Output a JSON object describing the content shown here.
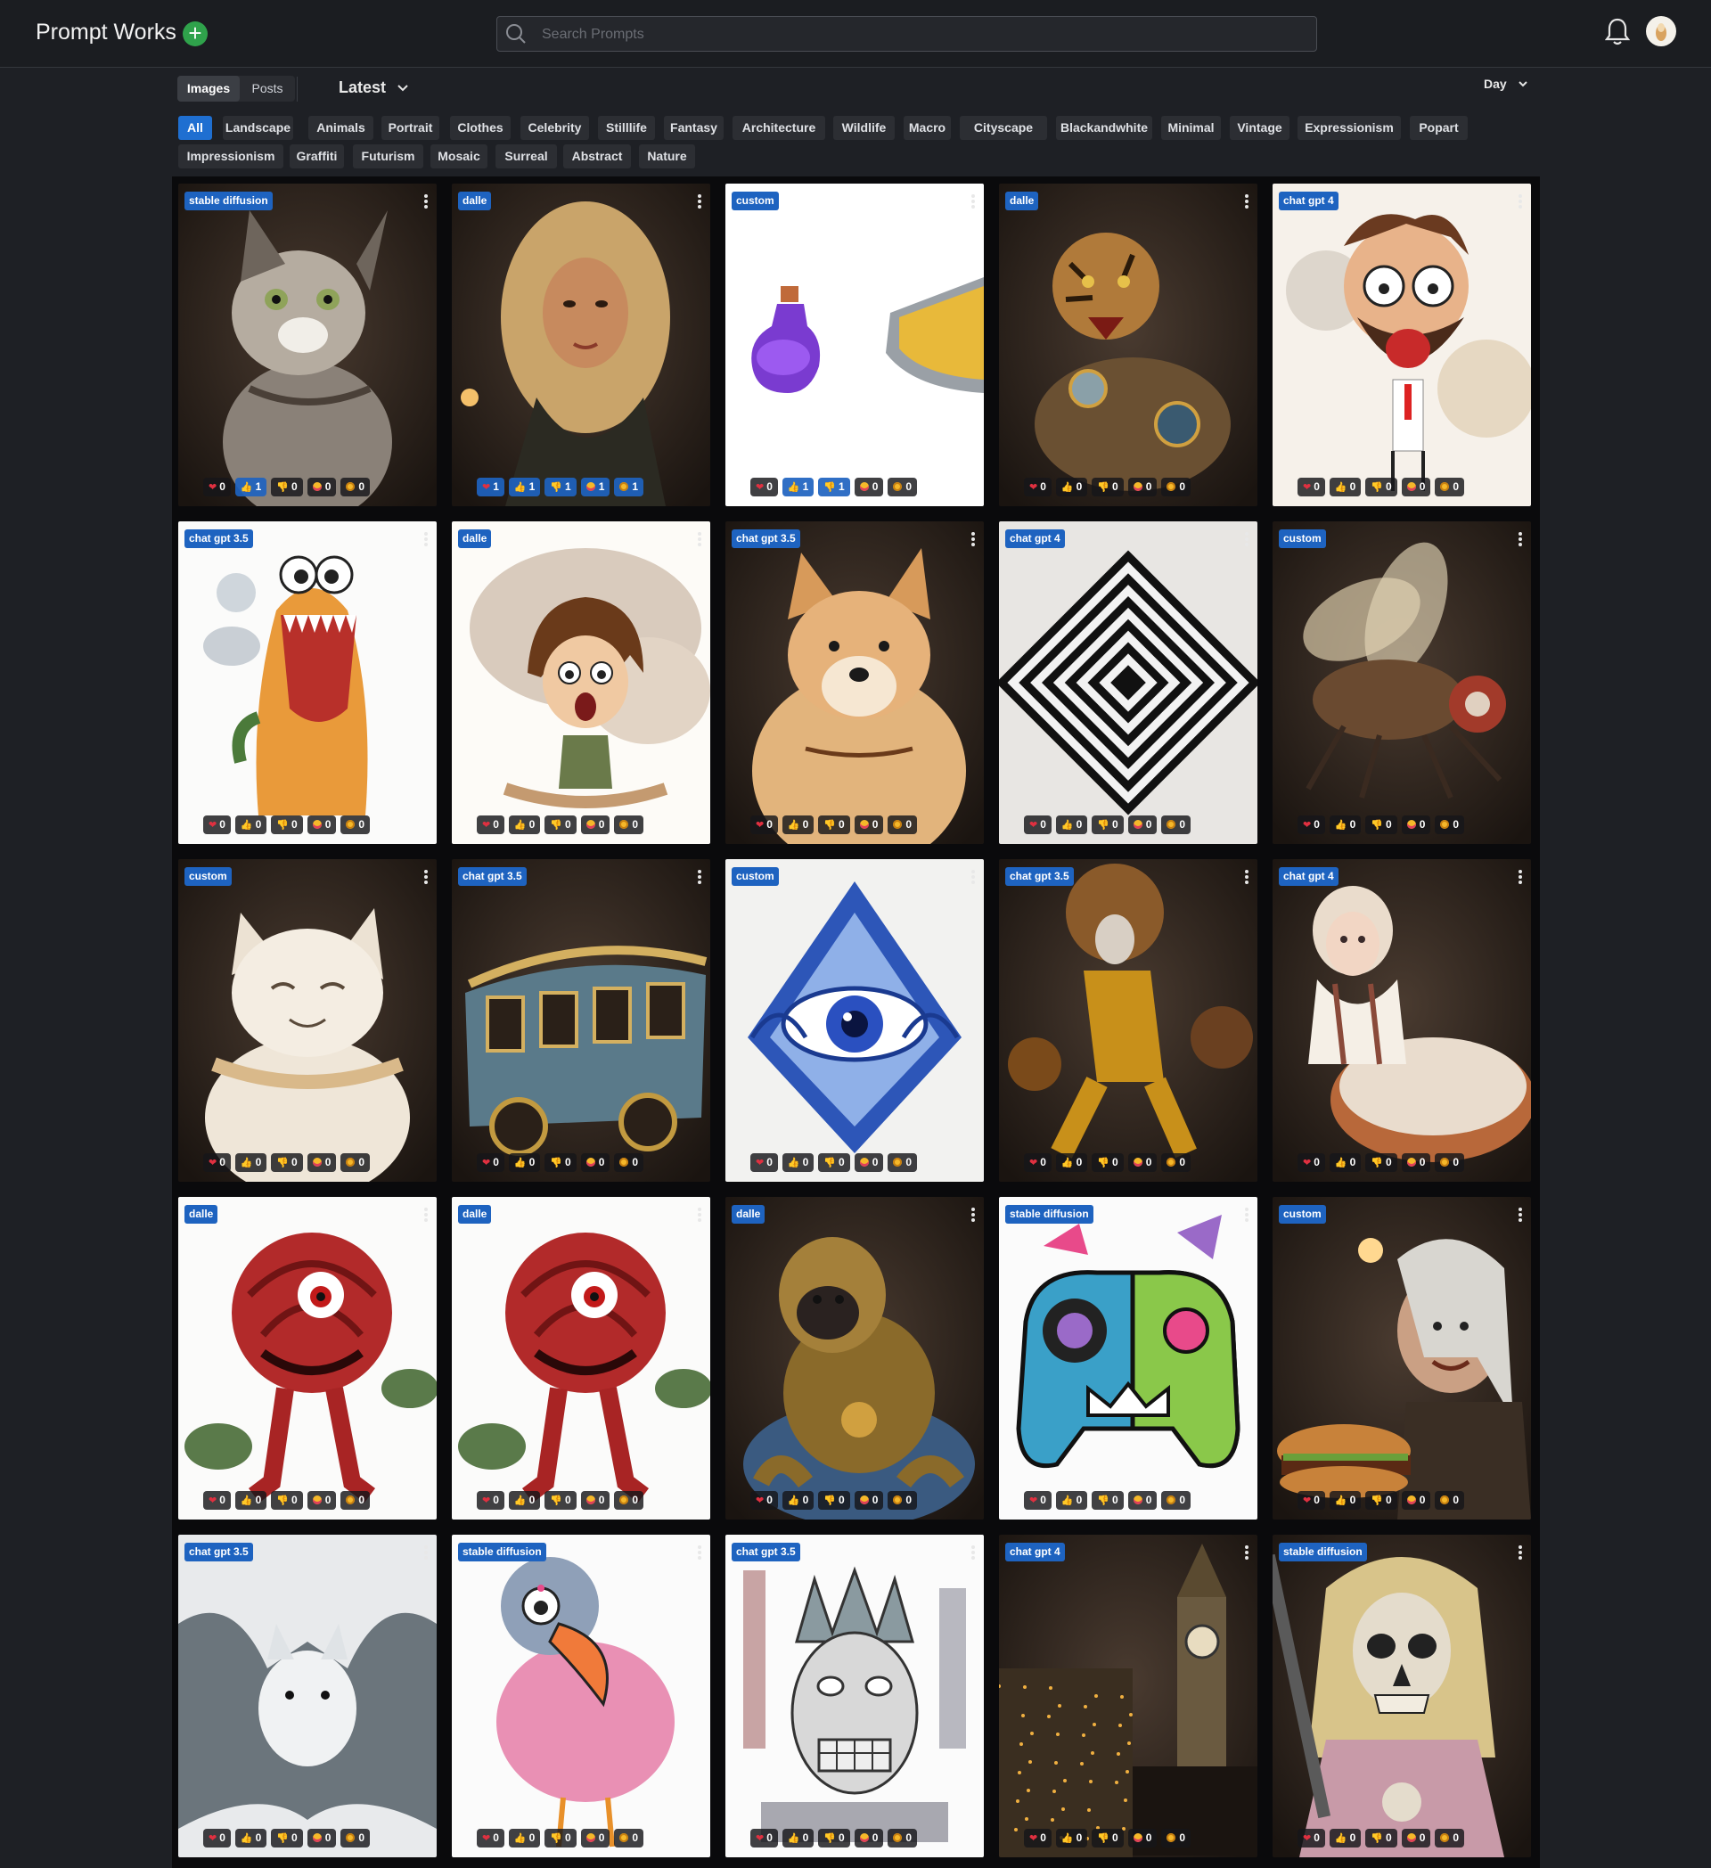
{
  "header": {
    "brand": "Prompt Works",
    "add_icon": "plus-circle-icon",
    "search_placeholder": "Search Prompts",
    "search_value": "",
    "notification_icon": "bell-icon",
    "avatar_icon": "user-avatar"
  },
  "toolbar": {
    "view_tabs": [
      {
        "label": "Images",
        "active": true
      },
      {
        "label": "Posts",
        "active": false
      }
    ],
    "sort_label": "Latest",
    "range_label": "Day"
  },
  "categories": [
    "All",
    "Landscape",
    "Animals",
    "Portrait",
    "Clothes",
    "Celebrity",
    "Stilllife",
    "Fantasy",
    "Architecture",
    "Wildlife",
    "Macro",
    "Cityscape",
    "Blackandwhite",
    "Minimal",
    "Vintage",
    "Expressionism",
    "Popart",
    "Impressionism",
    "Graffiti",
    "Futurism",
    "Mosaic",
    "Surreal",
    "Abstract",
    "Nature"
  ],
  "active_category": "All",
  "reaction_icons": [
    "heart",
    "thumbs-up",
    "thumbs-down",
    "love-face",
    "dizzy-face"
  ],
  "colors": {
    "accent": "#1e63c0",
    "add": "#2fa24b",
    "background": "#1e2025"
  },
  "cards": [
    {
      "model": "stable diffusion",
      "subject": "tabby-cat",
      "reactions": [
        0,
        1,
        0,
        0,
        0
      ]
    },
    {
      "model": "dalle",
      "subject": "blonde-woman-portrait",
      "reactions": [
        1,
        1,
        1,
        1,
        1
      ]
    },
    {
      "model": "custom",
      "subject": "potion-and-shield",
      "reactions": [
        0,
        1,
        1,
        0,
        0
      ]
    },
    {
      "model": "dalle",
      "subject": "mechanical-tiger",
      "reactions": [
        0,
        0,
        0,
        0,
        0
      ]
    },
    {
      "model": "chat gpt 4",
      "subject": "screaming-cartoon-man",
      "reactions": [
        0,
        0,
        0,
        0,
        0
      ]
    },
    {
      "model": "chat gpt 3.5",
      "subject": "orange-cartoon-monster",
      "reactions": [
        0,
        0,
        0,
        0,
        0
      ]
    },
    {
      "model": "dalle",
      "subject": "shocked-cartoon-kid",
      "reactions": [
        0,
        0,
        0,
        0,
        0
      ]
    },
    {
      "model": "chat gpt 3.5",
      "subject": "shiba-inu",
      "reactions": [
        0,
        0,
        0,
        0,
        0
      ]
    },
    {
      "model": "chat gpt 4",
      "subject": "op-art-squares",
      "reactions": [
        0,
        0,
        0,
        0,
        0
      ]
    },
    {
      "model": "custom",
      "subject": "mechanical-fly",
      "reactions": [
        0,
        0,
        0,
        0,
        0
      ]
    },
    {
      "model": "custom",
      "subject": "cream-cat",
      "reactions": [
        0,
        0,
        0,
        0,
        0
      ]
    },
    {
      "model": "chat gpt 3.5",
      "subject": "ornate-trolley",
      "reactions": [
        0,
        0,
        0,
        0,
        0
      ]
    },
    {
      "model": "custom",
      "subject": "blue-eye-ornament",
      "reactions": [
        0,
        0,
        0,
        0,
        0
      ]
    },
    {
      "model": "chat gpt 3.5",
      "subject": "golden-figure",
      "reactions": [
        0,
        0,
        0,
        0,
        0
      ]
    },
    {
      "model": "chat gpt 4",
      "subject": "girl-on-bread",
      "reactions": [
        0,
        0,
        0,
        0,
        0
      ]
    },
    {
      "model": "dalle",
      "subject": "rose-monster",
      "reactions": [
        0,
        0,
        0,
        0,
        0
      ]
    },
    {
      "model": "dalle",
      "subject": "rose-monster",
      "reactions": [
        0,
        0,
        0,
        0,
        0
      ]
    },
    {
      "model": "dalle",
      "subject": "golden-gorilla",
      "reactions": [
        0,
        0,
        0,
        0,
        0
      ]
    },
    {
      "model": "stable diffusion",
      "subject": "graffiti-gamepad",
      "reactions": [
        0,
        0,
        0,
        0,
        0
      ]
    },
    {
      "model": "custom",
      "subject": "witcher-burger",
      "reactions": [
        0,
        0,
        0,
        0,
        0
      ]
    },
    {
      "model": "chat gpt 3.5",
      "subject": "white-bat",
      "reactions": [
        0,
        0,
        0,
        0,
        0
      ]
    },
    {
      "model": "stable diffusion",
      "subject": "pink-bird",
      "reactions": [
        0,
        0,
        0,
        0,
        0
      ]
    },
    {
      "model": "chat gpt 3.5",
      "subject": "statue-of-liberty-sketch",
      "reactions": [
        0,
        0,
        0,
        0,
        0
      ]
    },
    {
      "model": "chat gpt 4",
      "subject": "night-city-big-ben",
      "reactions": [
        0,
        0,
        0,
        0,
        0
      ]
    },
    {
      "model": "stable diffusion",
      "subject": "skull-warrior",
      "reactions": [
        0,
        0,
        0,
        0,
        0
      ]
    }
  ]
}
